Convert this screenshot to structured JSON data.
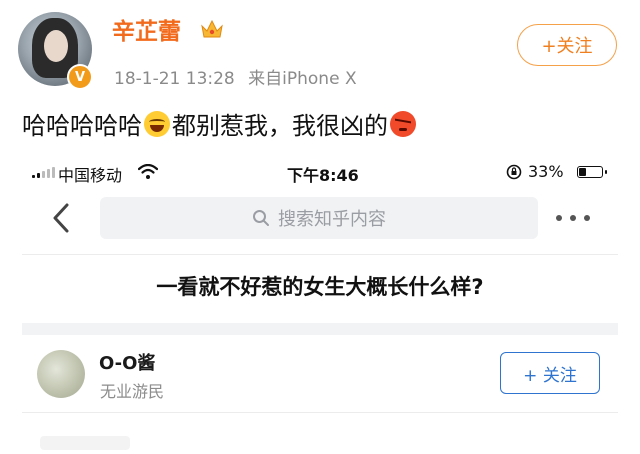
{
  "post": {
    "username": "辛芷蕾",
    "verified_badge": "V",
    "timestamp": "18-1-21 13:28",
    "source": "来自iPhone X",
    "follow_label": "+关注",
    "text_part1": "哈哈哈哈哈",
    "text_part2": "都别惹我，我很凶的",
    "icons": [
      "crown-icon",
      "laughing-emoji-icon",
      "angry-emoji-icon"
    ],
    "accent_color": "#f26b1d"
  },
  "phone": {
    "status_bar": {
      "carrier": "中国移动",
      "time": "下午8:46",
      "battery_percent": "33%",
      "battery_level": 0.33,
      "icons": [
        "signal-icon",
        "wifi-icon",
        "rotation-lock-icon",
        "battery-icon"
      ]
    },
    "nav": {
      "search_placeholder": "搜索知乎内容",
      "icons": [
        "back-arrow-icon",
        "search-icon",
        "more-icon"
      ]
    },
    "question_title": "一看就不好惹的女生大概长什么样?",
    "answer": {
      "author": "O-O酱",
      "bio": "无业游民",
      "follow_label": "+ 关注",
      "accent_color": "#2f74cf"
    }
  }
}
